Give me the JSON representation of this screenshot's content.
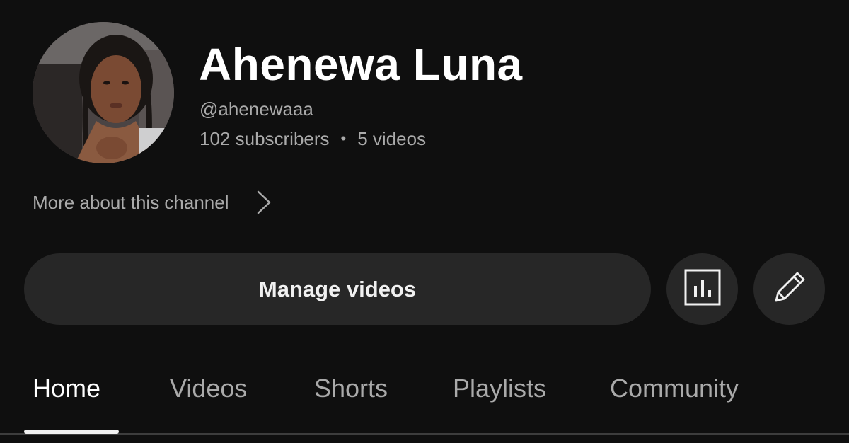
{
  "channel": {
    "name": "Ahenewa Luna",
    "handle": "@ahenewaaa",
    "subscribers": "102 subscribers",
    "separator": "•",
    "videos": "5 videos",
    "more_about": "More about this channel"
  },
  "actions": {
    "manage_videos": "Manage videos",
    "analytics_icon": "analytics-icon",
    "edit_icon": "pencil-icon"
  },
  "tabs": [
    {
      "label": "Home",
      "active": true
    },
    {
      "label": "Videos",
      "active": false
    },
    {
      "label": "Shorts",
      "active": false
    },
    {
      "label": "Playlists",
      "active": false
    },
    {
      "label": "Community",
      "active": false
    }
  ],
  "colors": {
    "background": "#0f0f0f",
    "button_bg": "#272727",
    "primary_text": "#f1f1f1",
    "secondary_text": "#aaaaaa"
  }
}
